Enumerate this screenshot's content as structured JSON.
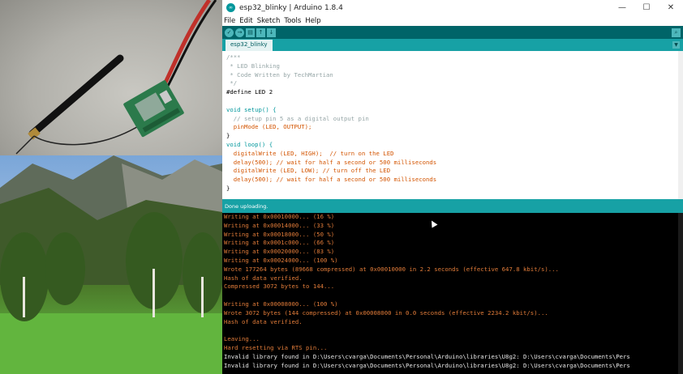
{
  "window": {
    "title": "esp32_blinky | Arduino 1.8.4",
    "minimize": "—",
    "maximize": "☐",
    "close": "✕"
  },
  "menu": [
    "File",
    "Edit",
    "Sketch",
    "Tools",
    "Help"
  ],
  "toolbar": {
    "verify_icon": "check-icon",
    "upload_icon": "arrow-right-icon",
    "new_icon": "new-file-icon",
    "open_icon": "arrow-up-icon",
    "save_icon": "arrow-down-icon",
    "serial_monitor_icon": "magnifier-icon"
  },
  "tabs": {
    "active": "esp32_blinky",
    "menu_arrow": "▼"
  },
  "editor": {
    "lines": [
      "/***",
      " * LED Blinking",
      " * Code Written by TechMartian",
      " */",
      "#define LED 2",
      "",
      "void setup() {",
      "  // setup pin 5 as a digital output pin",
      "  pinMode (LED, OUTPUT);",
      "}",
      "void loop() {",
      "  digitalWrite (LED, HIGH);  // turn on the LED",
      "  delay(500); // wait for half a second or 500 milliseconds",
      "  digitalWrite (LED, LOW); // turn off the LED",
      "  delay(500); // wait for half a second or 500 milliseconds",
      "}"
    ]
  },
  "status": {
    "text": "Done uploading."
  },
  "console": {
    "lines": [
      {
        "text": "Writing at 0x00010000... (16 %)",
        "color": "orange"
      },
      {
        "text": "Writing at 0x00014000... (33 %)",
        "color": "orange"
      },
      {
        "text": "Writing at 0x00018000... (50 %)",
        "color": "orange"
      },
      {
        "text": "Writing at 0x0001c000... (66 %)",
        "color": "orange"
      },
      {
        "text": "Writing at 0x00020000... (83 %)",
        "color": "orange"
      },
      {
        "text": "Writing at 0x00024000... (100 %)",
        "color": "orange"
      },
      {
        "text": "Wrote 177264 bytes (89668 compressed) at 0x00010000 in 2.2 seconds (effective 647.8 kbit/s)...",
        "color": "orange"
      },
      {
        "text": "Hash of data verified.",
        "color": "orange"
      },
      {
        "text": "Compressed 3072 bytes to 144...",
        "color": "orange"
      },
      {
        "text": "",
        "color": "orange"
      },
      {
        "text": "Writing at 0x00008000... (100 %)",
        "color": "orange"
      },
      {
        "text": "Wrote 3072 bytes (144 compressed) at 0x00008000 in 0.0 seconds (effective 2234.2 kbit/s)...",
        "color": "orange"
      },
      {
        "text": "Hash of data verified.",
        "color": "orange"
      },
      {
        "text": "",
        "color": "orange"
      },
      {
        "text": "Leaving...",
        "color": "orange"
      },
      {
        "text": "Hard resetting via RTS pin...",
        "color": "orange"
      },
      {
        "text": "Invalid library found in D:\\Users\\cvarga\\Documents\\Personal\\Arduino\\libraries\\U8g2: D:\\Users\\cvarga\\Documents\\Pers",
        "color": "white"
      },
      {
        "text": "Invalid library found in D:\\Users\\cvarga\\Documents\\Personal\\Arduino\\libraries\\U8g2: D:\\Users\\cvarga\\Documents\\Pers",
        "color": "white"
      }
    ]
  },
  "colors": {
    "toolbar_bg": "#006468",
    "tab_bg": "#17a1a5",
    "console_bg": "#000000",
    "console_orange": "#e07b39"
  }
}
